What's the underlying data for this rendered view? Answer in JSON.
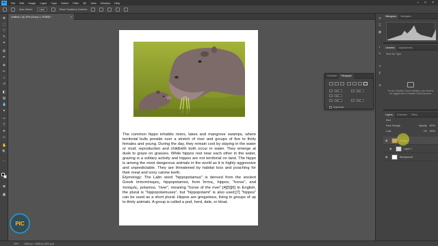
{
  "menubar": {
    "logo": "Ps",
    "items": [
      "File",
      "Edit",
      "Image",
      "Layer",
      "Type",
      "Select",
      "Filter",
      "3D",
      "View",
      "Window",
      "Help"
    ],
    "window_controls": [
      "–",
      "□",
      "×"
    ]
  },
  "options": {
    "auto_select_label": "Auto-Select:",
    "auto_select_value": "Layer",
    "transform_label": "Show Transform Controls"
  },
  "document": {
    "tab_title": "Untitled-1 @ 25% (Group 1, RGB/8) *",
    "close": "×"
  },
  "article": {
    "paragraph1": "The common hippo inhabits rivers, lakes and mangrove swamps, where territorial bulls preside over a stretch of river and groups of five to thirty females and young. During the day, they remain cool by staying in the water or mud; reproduction and childbirth both occur in water. They emerge at dusk to graze on grasses. While hippos rest near each other in the water, grazing is a solitary activity and hippos are not territorial on land. The hippo is among the most dangerous animals in the world as it is highly aggressive and unpredictable. They are threatened by habitat loss and poaching for their meat and ivory canine teeth.",
    "paragraph2": "Etymology: The Latin word \"hippopotamus\" is derived from the ancient Greek ἱπποπόταμος, hippopotamos, from ἵππος, hippos, \"horse\", and ποταμός, potamos, \"river\", meaning \"horse of the river\".[4][5][6] In English, the plural is \"hippopotamuses\", but \"hippopotami\" is also used;[7] \"hippos\" can be used as a short plural. Hippos are gregarious, living in groups of up to thirty animals. A group is called a pod, herd, dale, or bloat."
  },
  "status": {
    "zoom": "25%",
    "doc_size": "2480 px × 3508 px (300 ppi)"
  },
  "paragraph_panel": {
    "tabs": [
      "Character",
      "Paragraph"
    ],
    "field_values": [
      "0 pt",
      "0 pt",
      "0 pt",
      "0 pt",
      "0 pt"
    ],
    "hyphenate_label": "Hyphenate"
  },
  "right_panels": {
    "top_tabs": [
      "Histogram",
      "Navigator"
    ],
    "lib_tabs": [
      "Libraries",
      "Adjustments"
    ],
    "view_by": "View by: Type",
    "lib_message": "To use Creative Cloud Libraries, you need to be logged into a Creative Cloud account.",
    "layers_tabs": [
      "Layers",
      "Channels",
      "Paths"
    ],
    "kind_label": "Kind",
    "blend_mode": "Pass Through",
    "opacity_label": "Opacity:",
    "opacity_value": "100%",
    "lock_label": "Lock:",
    "fill_label": "Fill:",
    "fill_value": "100%",
    "layers": [
      {
        "name": "Group 1",
        "selected": true
      },
      {
        "name": "Layer 1",
        "selected": false
      },
      {
        "name": "Background",
        "selected": false
      }
    ]
  },
  "watermark": {
    "text": "PIC"
  }
}
